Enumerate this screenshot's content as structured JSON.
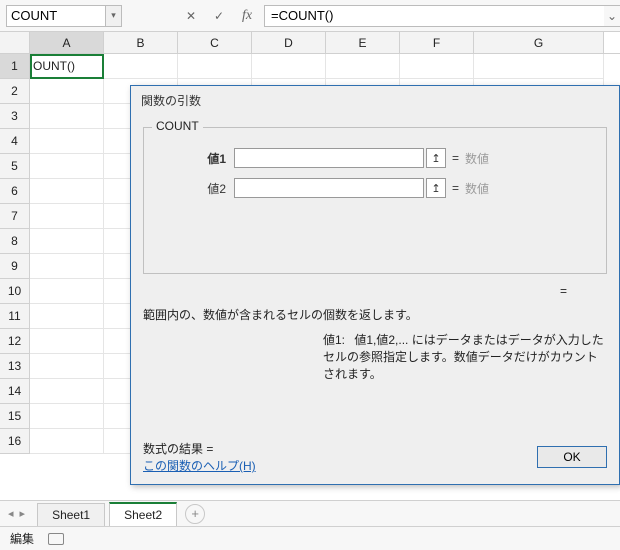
{
  "formula_bar": {
    "name_box": "COUNT",
    "formula": "=COUNT()",
    "cancel_glyph": "✕",
    "confirm_glyph": "✓",
    "fx_glyph": "fx",
    "dropdown_glyph": "▾",
    "expand_glyph": "⌄"
  },
  "grid": {
    "columns": [
      "A",
      "B",
      "C",
      "D",
      "E",
      "F",
      "G"
    ],
    "active_cell": "A1",
    "a1_value": "OUNT()",
    "row_count": 16
  },
  "dialog": {
    "title": "関数の引数",
    "function_name": "COUNT",
    "args": [
      {
        "label": "値1",
        "value": "",
        "hint": "数値",
        "bold": true
      },
      {
        "label": "値2",
        "value": "",
        "hint": "数値",
        "bold": false
      }
    ],
    "pick_glyph": "↥",
    "eq_glyph": "=",
    "result_eq": "=",
    "description": "範囲内の、数値が含まれるセルの個数を返します。",
    "param_name": "値1:",
    "param_desc": "値1,値2,... にはデータまたはデータが入力したセルの参照指定します。数値データだけがカウントされます。",
    "result_label": "数式の結果 =",
    "help_link": "この関数のヘルプ(H)",
    "ok_label": "OK"
  },
  "tabs": {
    "items": [
      "Sheet1",
      "Sheet2"
    ],
    "active_index": 1,
    "nav_prev": "◂",
    "nav_next": "▸",
    "add_glyph": "+"
  },
  "status": {
    "mode": "編集"
  }
}
